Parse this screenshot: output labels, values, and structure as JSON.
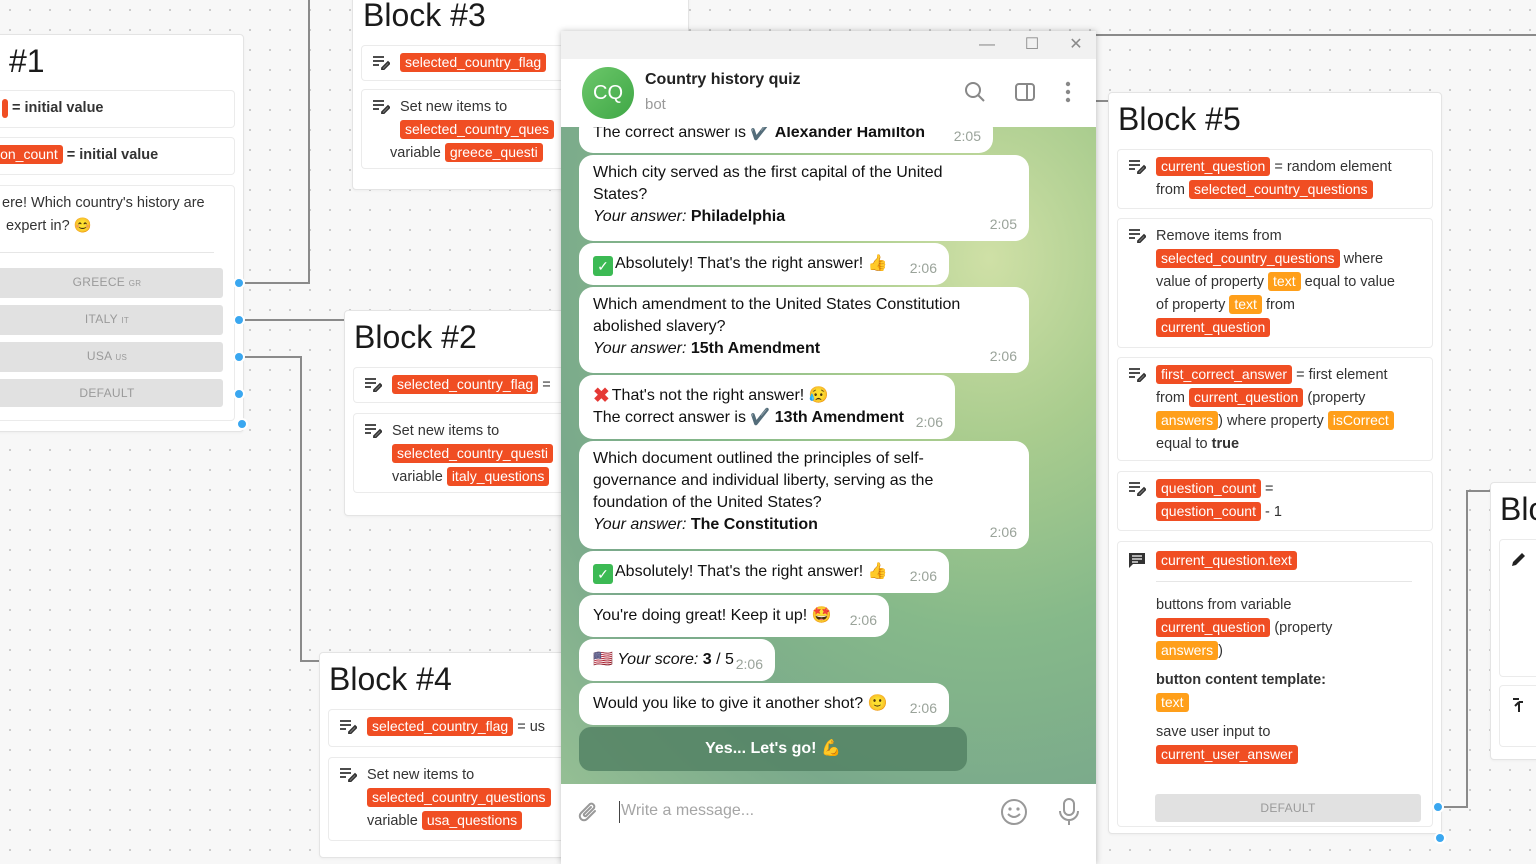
{
  "block1": {
    "title": "#1",
    "row1_tag": "",
    "row1_text": "= initial value",
    "row2_tag": "ion_count",
    "row2_text": "= initial value",
    "message_line1": "ere! Which country's history are",
    "message_line2": "expert in? 😊",
    "buttons": [
      {
        "label": "GREECE",
        "flag": "GR"
      },
      {
        "label": "ITALY",
        "flag": "IT"
      },
      {
        "label": "USA",
        "flag": "US"
      },
      {
        "label": "DEFAULT",
        "flag": ""
      }
    ]
  },
  "block2": {
    "title": "Block #2",
    "set_tag": "selected_country_flag",
    "set_suffix": "=",
    "list_text": "Set new items to",
    "list_tag": "selected_country_questi",
    "variable_text": "variable",
    "variable_tag": "italy_questions"
  },
  "block3": {
    "title": "Block #3",
    "set_tag": "selected_country_flag",
    "list_text": "Set new items to",
    "list_tag": "selected_country_ques",
    "variable_text": "variable",
    "variable_tag": "greece_questi"
  },
  "block4": {
    "title": "Block #4",
    "set_tag": "selected_country_flag",
    "set_suffix": "= us",
    "list_text": "Set new items to",
    "list_tag": "selected_country_questions",
    "variable_text": "variable",
    "variable_tag": "usa_questions"
  },
  "block5": {
    "title": "Block #5",
    "item1": {
      "tag1": "current_question",
      "text1": "= random element",
      "text2": "from",
      "tag2": "selected_country_questions"
    },
    "item2": {
      "text1": "Remove items from",
      "tag1": "selected_country_questions",
      "text2": "where",
      "text3": "value of property",
      "tag2": "text",
      "text4": "equal to value",
      "text5": "of property",
      "tag3": "text",
      "text6": "from",
      "tag4": "current_question"
    },
    "item3": {
      "tag1": "first_correct_answer",
      "text1": "= first element",
      "text2": "from",
      "tag2": "current_question",
      "text3": "(property",
      "tag3": "answers",
      "text4": ") where property",
      "tag4": "isCorrect",
      "text5": "equal to",
      "text6": "true"
    },
    "item4": {
      "tag1": "question_count",
      "text1": "=",
      "tag2": "question_count",
      "text2": "- 1"
    },
    "item5": {
      "tag1": "current_question.text",
      "text1": "buttons from variable",
      "tag2": "current_question",
      "text2": "(property",
      "tag3": "answers",
      "text3": ")",
      "template_label": "button content template:",
      "tag4": "text",
      "save_label": "save user input to",
      "tag5": "current_user_answer",
      "default_label": "DEFAULT"
    }
  },
  "block6": {
    "title": "Blo"
  },
  "telegram": {
    "window_controls": {
      "minimize": "—",
      "maximize": "☐",
      "close": "✕"
    },
    "avatar": "CQ",
    "chat_name": "Country history quiz",
    "chat_status": "bot",
    "messages": [
      {
        "id": "m0",
        "text": "The correct answer is ✔️",
        "bold": "Alexander Hamilton",
        "time": "2:05"
      },
      {
        "id": "m1",
        "question": "Which city served as the first capital of the United States?",
        "your_answer_label": "Your answer:",
        "answer": "Philadelphia",
        "time": "2:05"
      },
      {
        "id": "m2",
        "text": "Absolutely! That's the right answer! 👍",
        "time": "2:06"
      },
      {
        "id": "m3",
        "question": "Which amendment to the United States Constitution abolished slavery?",
        "your_answer_label": "Your answer:",
        "answer": "15th Amendment",
        "time": "2:06"
      },
      {
        "id": "m4",
        "line1": "That's not the right answer! 😥",
        "line2": "The correct answer is ✔️",
        "bold": "13th Amendment",
        "time": "2:06"
      },
      {
        "id": "m5",
        "question": "Which document outlined the principles of self-governance and individual liberty, serving as the foundation of the United States?",
        "your_answer_label": "Your answer:",
        "answer": "The Constitution",
        "time": "2:06"
      },
      {
        "id": "m6",
        "text": "Absolutely! That's the right answer! 👍",
        "time": "2:06"
      },
      {
        "id": "m7",
        "text": "You're doing great! Keep it up! 🤩",
        "time": "2:06"
      },
      {
        "id": "m8",
        "flag": "🇺🇸",
        "score_label": "Your score:",
        "score": "3",
        "total": "/ 5",
        "time": "2:06"
      },
      {
        "id": "m9",
        "text": "Would you like to give it another shot? 🙂",
        "time": "2:06"
      }
    ],
    "inline_button": "Yes... Let's go! 💪",
    "input_placeholder": "Write a message..."
  },
  "colors": {
    "tag": "#f04e23",
    "tag_orange": "#ff9f1a",
    "connector_dot": "#3aa7f0"
  }
}
